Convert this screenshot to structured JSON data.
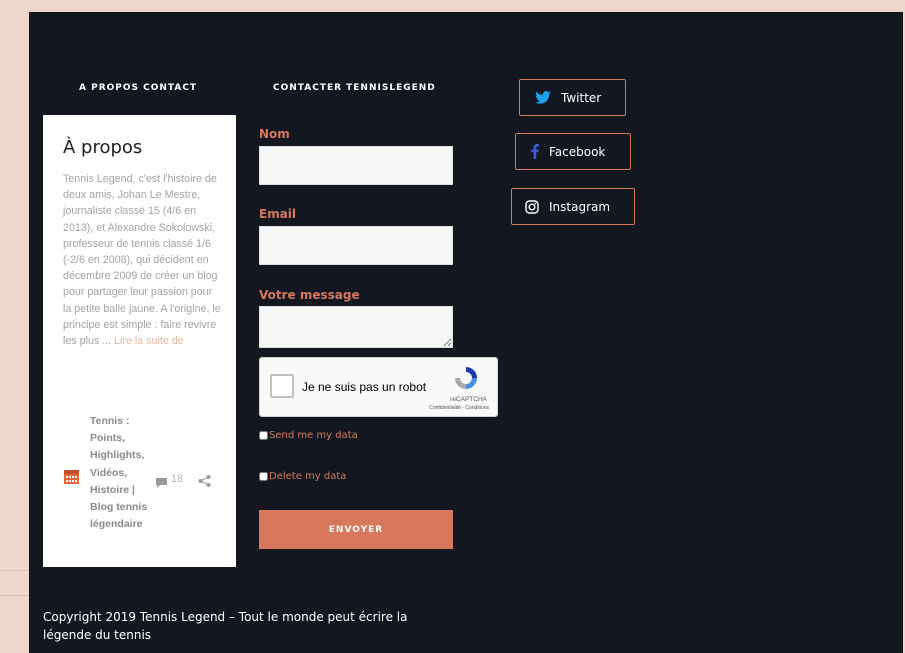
{
  "headings": {
    "about_contact": "A PROPOS CONTACT",
    "contact_form": "CONTACTER TENNISLEGEND"
  },
  "about": {
    "title": "À propos",
    "text": "Tennis Legend, c'est l'histoire de deux amis, Johan Le Mestre, journaliste classé 15 (4/6 en 2013), et Alexandre Sokolowski, professeur de tennis classé 1/6 (-2/6 en 2008), qui décident en décembre 2009 de créer un blog pour partager leur passion pour la petite balle jaune. A l'origine, le principe est simple : faire revivre les plus ...",
    "read_more": "Lire la suite de",
    "categories": "Tennis : Points, Highlights, Vidéos, Histoire | Blog tennis légendaire",
    "comment_count": "18"
  },
  "form": {
    "name_label": "Nom",
    "email_label": "Email",
    "message_label": "Votre message",
    "captcha_label": "Je ne suis pas un robot",
    "captcha_brand": "reCAPTCHA",
    "captcha_links": "Confidentialité - Conditions",
    "send_data_label": "Send me my data",
    "delete_data_label": "Delete my data",
    "submit_label": "ENVOYER"
  },
  "social": {
    "twitter": "Twitter",
    "facebook": "Facebook",
    "instagram": "Instagram"
  },
  "footer": {
    "copyright": "Copyright 2019 Tennis Legend – Tout le monde peut écrire la légende du tennis"
  },
  "colors": {
    "panel_bg": "#131820",
    "accent": "#d7775b",
    "page_bg": "#eed6cd",
    "twitter_blue": "#1da1f2",
    "facebook_blue": "#3b5bdb"
  }
}
